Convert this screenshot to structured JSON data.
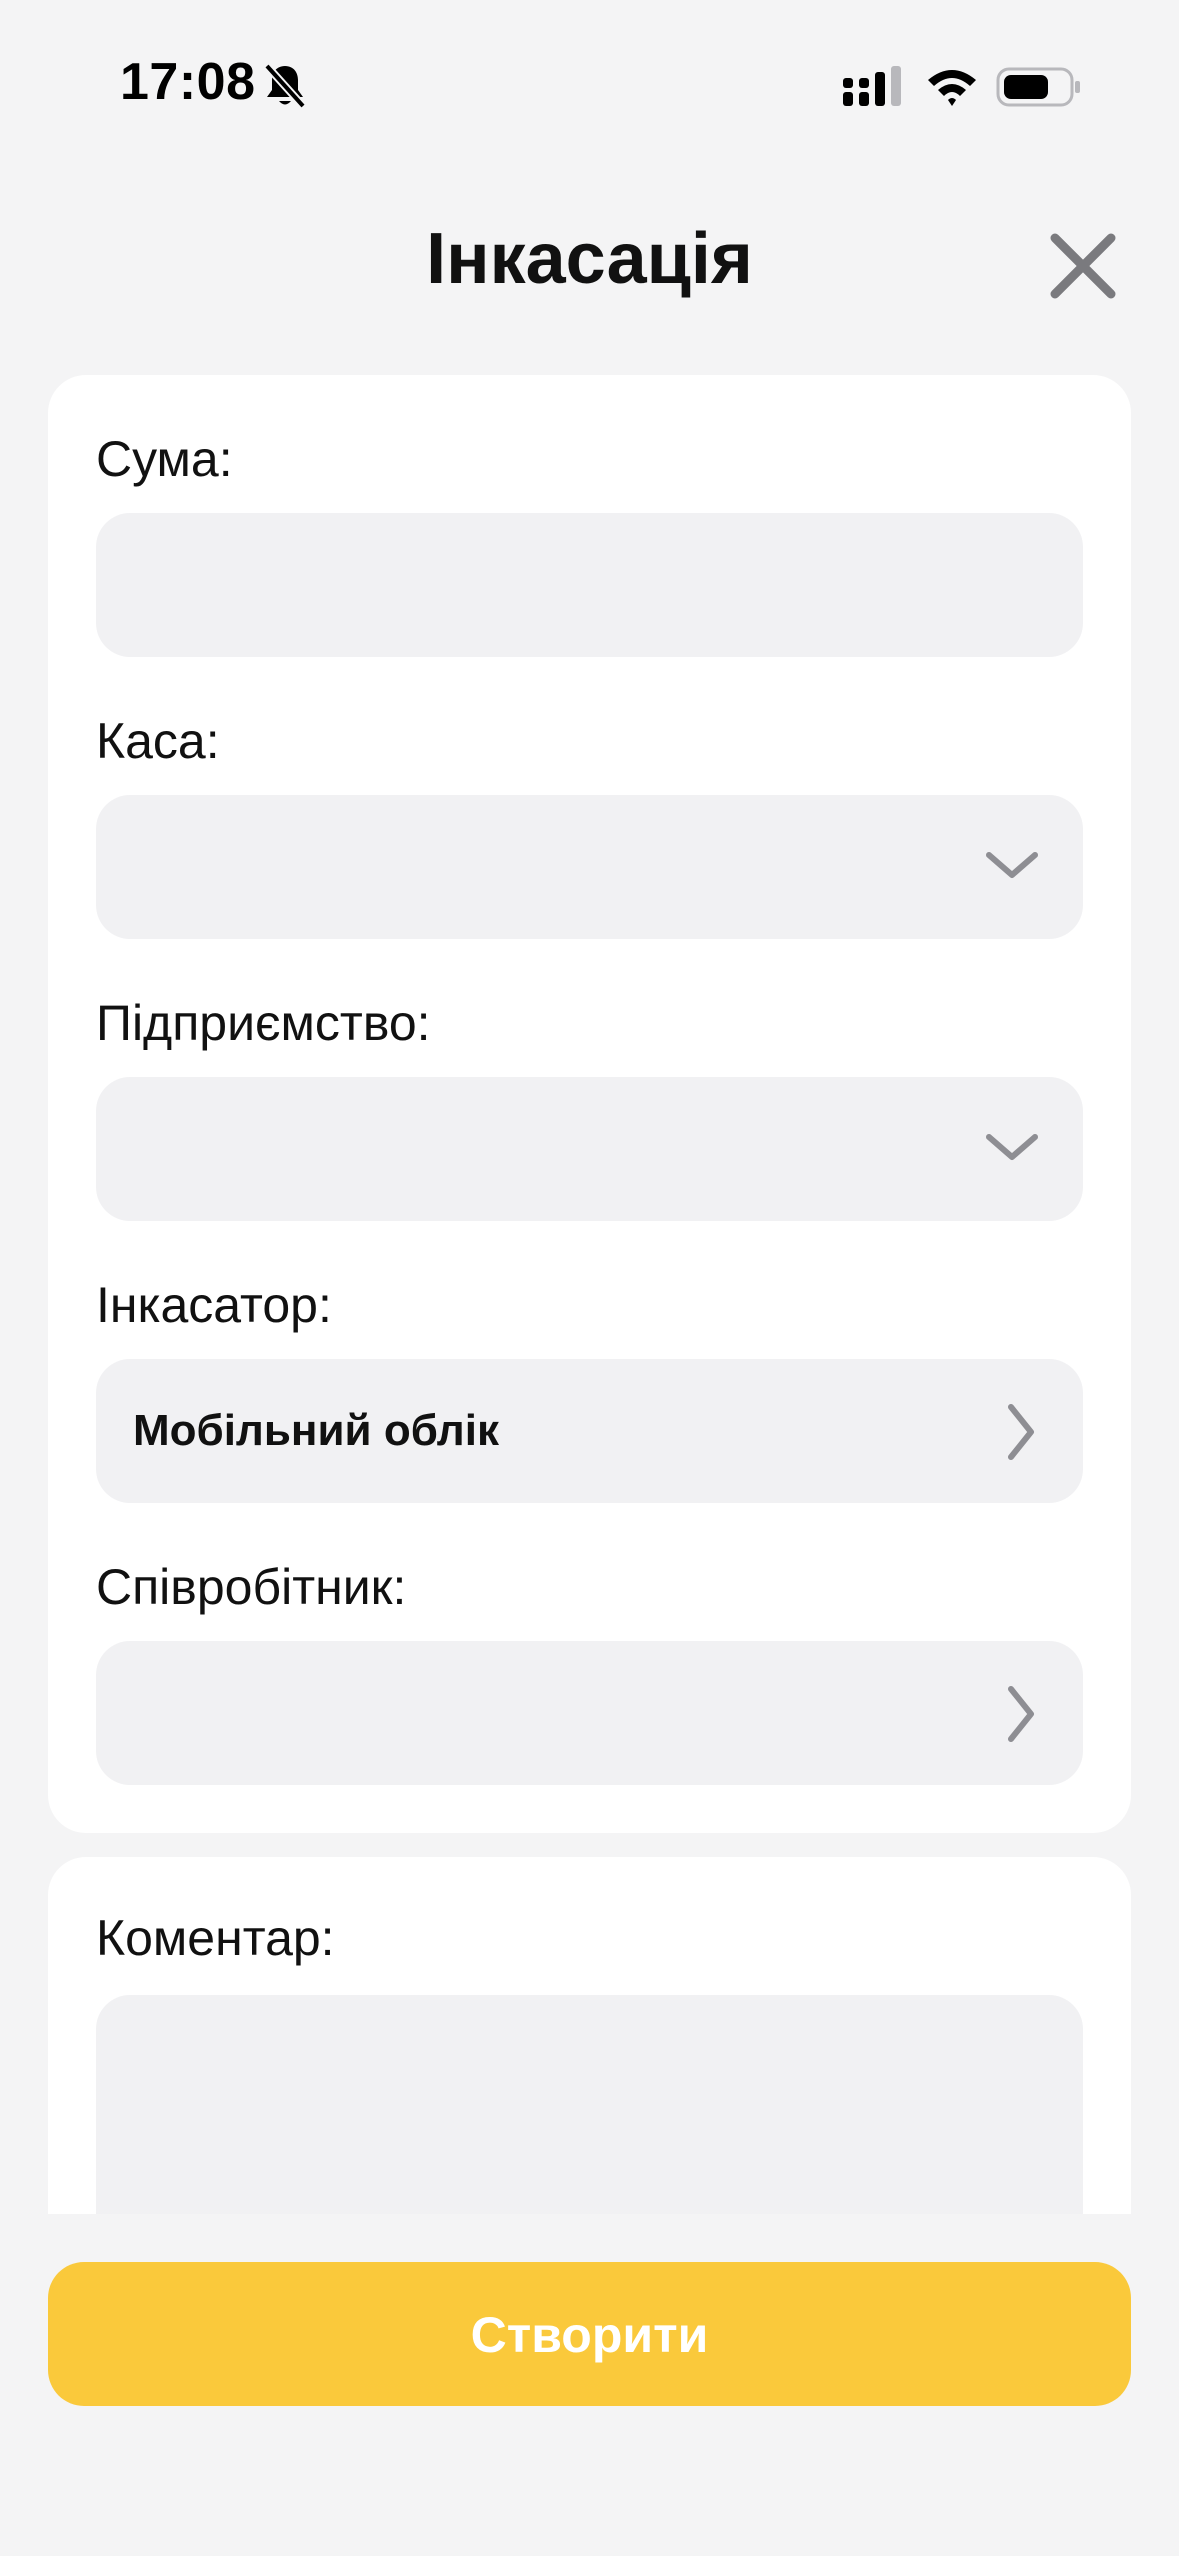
{
  "status_bar": {
    "time": "17:08",
    "icons": [
      "bell-muted-icon",
      "signal-icon",
      "wifi-icon",
      "battery-icon"
    ]
  },
  "header": {
    "title": "Інкасація",
    "close_icon": "close-icon"
  },
  "form": {
    "amount": {
      "label": "Сума:",
      "value": "",
      "placeholder": ""
    },
    "cash_register": {
      "label": "Каса:",
      "value": "",
      "control": "dropdown"
    },
    "enterprise": {
      "label": "Підприємство:",
      "value": "",
      "control": "dropdown"
    },
    "collector": {
      "label": "Інкасатор:",
      "value": "Мобільний облік",
      "control": "picker"
    },
    "employee": {
      "label": "Співробітник:",
      "value": "",
      "control": "picker"
    }
  },
  "comment": {
    "label": "Коментар:",
    "value": ""
  },
  "actions": {
    "create_label": "Створити"
  },
  "colors": {
    "background": "#f4f4f5",
    "card": "#ffffff",
    "field": "#f1f1f3",
    "accent": "#fac93b",
    "icon_gray": "#8e8e93"
  }
}
